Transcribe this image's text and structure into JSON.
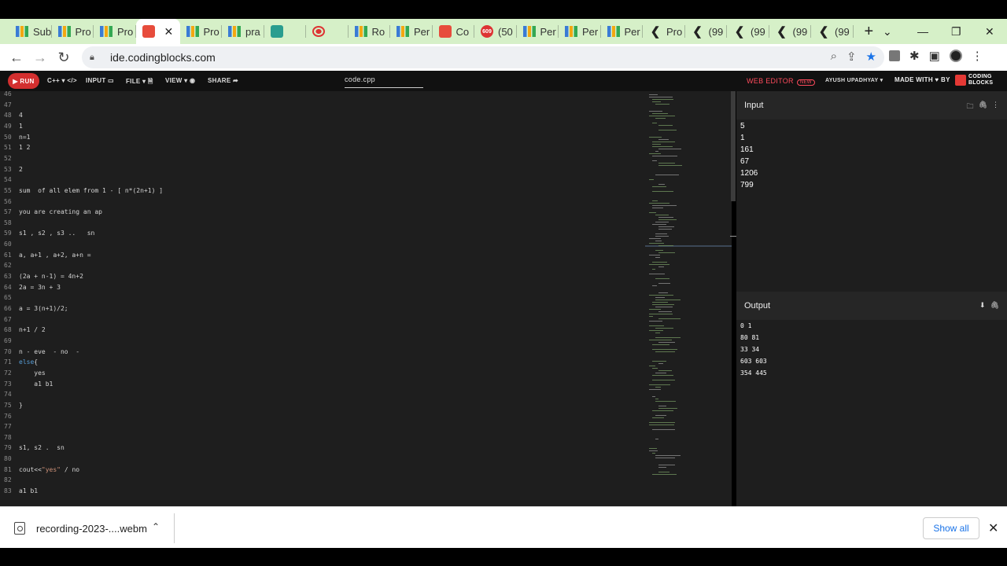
{
  "browser": {
    "tabs": [
      {
        "label": "Sub",
        "icon": "bar-chart-icon"
      },
      {
        "label": "Pro",
        "icon": "bar-chart-icon"
      },
      {
        "label": "Pro",
        "icon": "bar-chart-icon"
      },
      {
        "label": "",
        "icon": "coding-blocks-icon",
        "active": true
      },
      {
        "label": "Pro",
        "icon": "bar-chart-icon"
      },
      {
        "label": "pra",
        "icon": "bar-chart-icon"
      },
      {
        "label": "",
        "icon": "ghost-icon"
      },
      {
        "label": "",
        "icon": "record-icon"
      },
      {
        "label": "Ro",
        "icon": "bar-chart-icon"
      },
      {
        "label": "Per",
        "icon": "bar-chart-icon"
      },
      {
        "label": "Co",
        "icon": "coding-blocks-icon"
      },
      {
        "label": "(50",
        "icon": "notification-badge-icon",
        "badge": "609"
      },
      {
        "label": "Per",
        "icon": "bar-chart-icon"
      },
      {
        "label": "Per",
        "icon": "bar-chart-icon"
      },
      {
        "label": "Per",
        "icon": "bar-chart-icon"
      },
      {
        "label": "Pro",
        "icon": "hook-icon"
      },
      {
        "label": "(99",
        "icon": "hook-icon"
      },
      {
        "label": "(99",
        "icon": "hook-icon"
      },
      {
        "label": "(99",
        "icon": "hook-icon"
      },
      {
        "label": "(99",
        "icon": "hook-icon"
      }
    ],
    "active_close": "✕",
    "new_tab": "+",
    "window_controls": {
      "dropdown": "⌄",
      "minimize": "—",
      "restore": "❐",
      "close": "✕"
    },
    "url": "ide.codingblocks.com"
  },
  "toolbar": {
    "run": "▶ RUN",
    "language": "C++ ▾ </>",
    "input": "INPUT ▭",
    "file": "FILE ▾ 🗎",
    "view": "VIEW ▾ ◉",
    "share": "SHARE ➦",
    "filename": "code.cpp",
    "web_editor": "WEB EDITOR",
    "new_badge": "NEW",
    "user": "AYUSH UPADHYAY ▾",
    "made_with": "MADE WITH ♥ BY",
    "logo_line1": "CODING",
    "logo_line2": "BLOCKS",
    "heart_color": "#e53935",
    "accent": "#d32f2f"
  },
  "code": {
    "lines": [
      {
        "n": "46",
        "t": ""
      },
      {
        "n": "47",
        "t": ""
      },
      {
        "n": "48",
        "t": "4"
      },
      {
        "n": "49",
        "t": "1"
      },
      {
        "n": "50",
        "t": "n=1"
      },
      {
        "n": "51",
        "t": "1 2"
      },
      {
        "n": "52",
        "t": ""
      },
      {
        "n": "53",
        "t": "2"
      },
      {
        "n": "54",
        "t": ""
      },
      {
        "n": "55",
        "t": "sum  of all elem from 1 - [ n*(2n+1) ]"
      },
      {
        "n": "56",
        "t": ""
      },
      {
        "n": "57",
        "t": "you are creating an ap"
      },
      {
        "n": "58",
        "t": ""
      },
      {
        "n": "59",
        "t": "s1 , s2 , s3 ..   sn"
      },
      {
        "n": "60",
        "t": ""
      },
      {
        "n": "61",
        "t": "a, a+1 , a+2, a+n ="
      },
      {
        "n": "62",
        "t": ""
      },
      {
        "n": "63",
        "t": "(2a + n-1) = 4n+2"
      },
      {
        "n": "64",
        "t": "2a = 3n + 3"
      },
      {
        "n": "65",
        "t": ""
      },
      {
        "n": "66",
        "t": "a = 3(n+1)/2;"
      },
      {
        "n": "67",
        "t": ""
      },
      {
        "n": "68",
        "t": "n+1 / 2"
      },
      {
        "n": "69",
        "t": ""
      },
      {
        "n": "70",
        "t": "n - eve  - no  -"
      },
      {
        "n": "71",
        "t": "else{",
        "kw": "else"
      },
      {
        "n": "72",
        "t": "    yes"
      },
      {
        "n": "73",
        "t": "    a1 b1"
      },
      {
        "n": "74",
        "t": ""
      },
      {
        "n": "75",
        "t": "}"
      },
      {
        "n": "76",
        "t": ""
      },
      {
        "n": "77",
        "t": ""
      },
      {
        "n": "78",
        "t": ""
      },
      {
        "n": "79",
        "t": "s1, s2 .  sn"
      },
      {
        "n": "80",
        "t": ""
      },
      {
        "n": "81",
        "t": "cout<<\"yes\" / no",
        "str": "\"yes\""
      },
      {
        "n": "82",
        "t": ""
      },
      {
        "n": "83",
        "t": "a1 b1"
      }
    ]
  },
  "input_panel": {
    "title": "Input",
    "icons": [
      "folder-icon",
      "attach-icon",
      "more-icon"
    ],
    "values": [
      "5",
      "1",
      "161",
      "67",
      "1206",
      "799"
    ]
  },
  "output_panel": {
    "title": "Output",
    "icons": [
      "download-icon",
      "attach-icon"
    ],
    "values": [
      "0 1",
      "80 81",
      "33 34",
      "603 603",
      "354 445"
    ]
  },
  "downloads": {
    "filename": "recording-2023-....webm",
    "show_all": "Show all",
    "close": "✕"
  }
}
